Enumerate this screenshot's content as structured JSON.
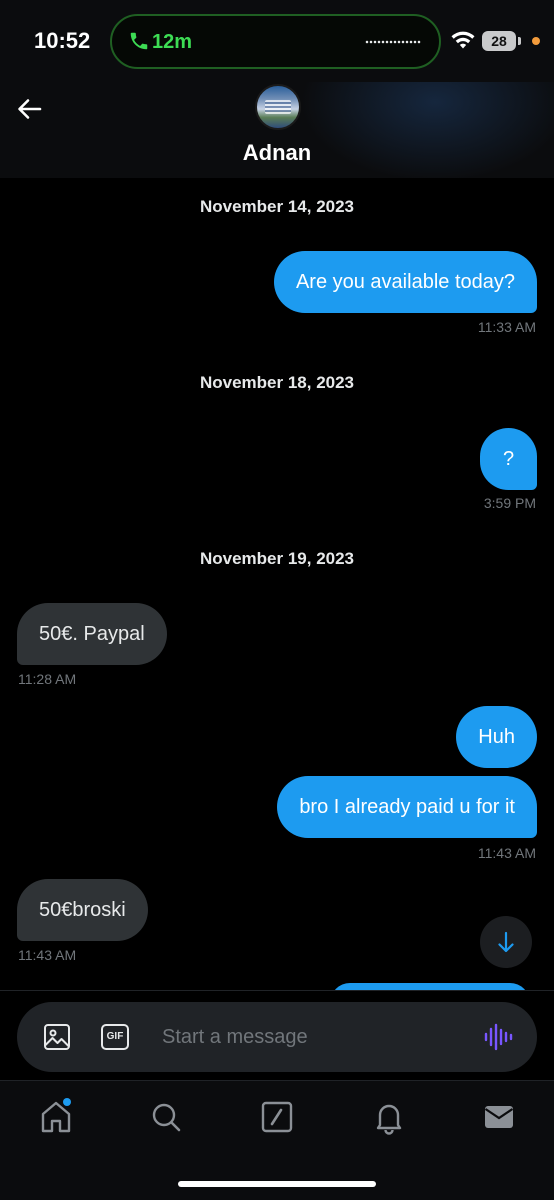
{
  "status_bar": {
    "time": "10:52",
    "call_duration": "12m",
    "battery": "28"
  },
  "header": {
    "contact_name": "Adnan"
  },
  "messages": {
    "date_1": "November 14, 2023",
    "m1_text": "Are you available today?",
    "m1_time": "11:33 AM",
    "date_2": "November 18, 2023",
    "m2_text": "?",
    "m2_time": "3:59 PM",
    "date_3": "November 19, 2023",
    "m3_text": "50€. Paypal",
    "m3_time": "11:28 AM",
    "m4_text": "Huh",
    "m5_text": "bro I already paid u for it",
    "m5_time": "11:43 AM",
    "m6_text": "50€broski",
    "m6_time": "11:43 AM"
  },
  "composer": {
    "placeholder": "Start a message",
    "gif_label": "GIF"
  },
  "icons": {
    "back": "back-arrow-icon",
    "image": "image-icon",
    "gif": "gif-icon",
    "voice": "voice-waveform-icon",
    "scroll_down": "arrow-down-icon",
    "nav": [
      "home-icon",
      "search-icon",
      "compose-icon",
      "notifications-icon",
      "messages-icon"
    ]
  },
  "colors": {
    "accent": "#1d9bf0",
    "incoming_bubble": "#2f3336",
    "call_green": "#3ddc54",
    "voice_purple": "#7856ff"
  }
}
